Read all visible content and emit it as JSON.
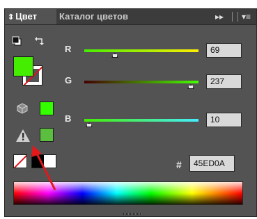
{
  "tabs": {
    "active": "Цвет",
    "inactive": "Каталог цветов"
  },
  "channels": [
    {
      "label": "R",
      "value": "69",
      "fraction": 0.27,
      "gradient": "linear-gradient(to right, #45ED00, #ffed00)"
    },
    {
      "label": "G",
      "value": "237",
      "fraction": 0.93,
      "gradient": "linear-gradient(to right, #450000, #45ff00)"
    },
    {
      "label": "B",
      "value": "10",
      "fraction": 0.04,
      "gradient": "linear-gradient(to right, #45ED00, #45EDff)"
    }
  ],
  "hex": {
    "symbol": "#",
    "value": "45ED0A"
  },
  "colors": {
    "fill": "#45ED00",
    "web_safe": "#33FF00",
    "in_gamut": "#5BBE3F",
    "annotation_arrow": "#e2191b"
  }
}
